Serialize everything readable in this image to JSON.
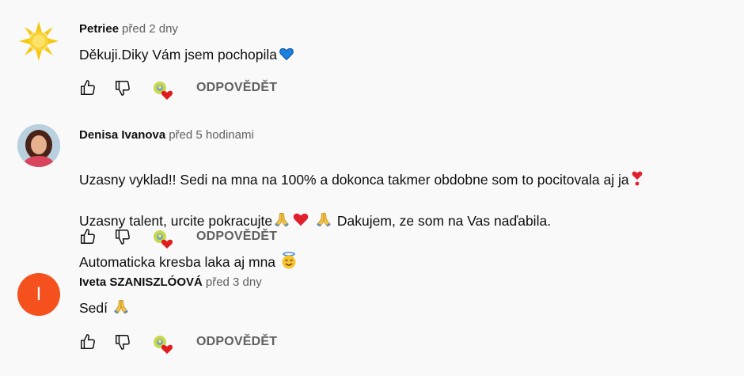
{
  "comments": [
    {
      "author": "Petriee",
      "time": "před 2 dny",
      "lines": [
        "Děkuji.Diky Vám jsem pochopila"
      ],
      "reply_label": "ODPOVĚDĚT",
      "avatar": "sun-avatar"
    },
    {
      "author": "Denisa Ivanova",
      "time": "před 5 hodinami",
      "lines": [
        "Uzasny vyklad!! Sedi na mna na 100% a dokonca takmer obdobne som to pocitovala aj ja",
        "Uzasny talent, urcite pokracujte",
        "Dakujem, ze som na Vas naďabila.",
        "Automaticka kresba laka aj mna"
      ],
      "reply_label": "ODPOVĚDĚT",
      "avatar": "photo-avatar"
    },
    {
      "author": "Iveta SZANISZLÓOVÁ",
      "time": "před 3 dny",
      "lines": [
        "Sedí"
      ],
      "reply_label": "ODPOVĚDĚT",
      "avatar": "letter-avatar",
      "avatar_letter": "I",
      "avatar_color": "#f4511e"
    }
  ],
  "icons": [
    "like-icon",
    "dislike-icon",
    "creator-heart-icon",
    "blue-heart-emoji",
    "heart-exclamation-emoji",
    "folded-hands-emoji",
    "red-heart-emoji",
    "smiling-halo-emoji"
  ]
}
